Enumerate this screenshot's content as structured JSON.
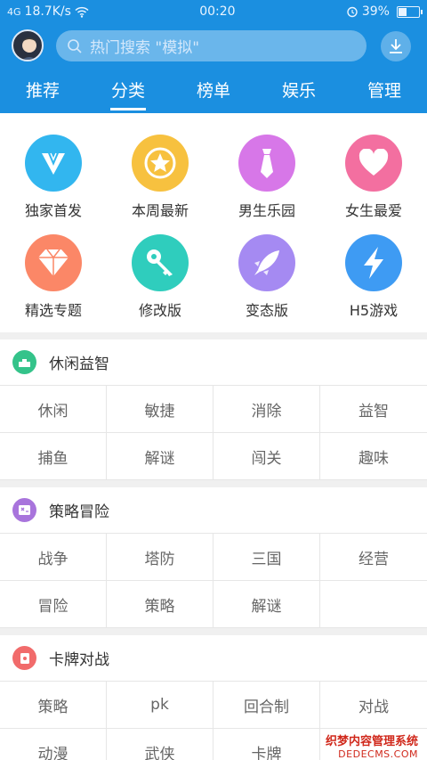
{
  "status": {
    "signal": "4G",
    "speed": "18.7K/s",
    "time": "00:20",
    "battery": "39%"
  },
  "search": {
    "placeholder": "热门搜索 \"模拟\""
  },
  "tabs": [
    {
      "label": "推荐",
      "active": false
    },
    {
      "label": "分类",
      "active": true
    },
    {
      "label": "榜单",
      "active": false
    },
    {
      "label": "娱乐",
      "active": false
    },
    {
      "label": "管理",
      "active": false
    }
  ],
  "categories": [
    {
      "label": "独家首发",
      "icon": "v-logo-icon",
      "color": "#32b6ef"
    },
    {
      "label": "本周最新",
      "icon": "star-badge-icon",
      "color": "#f7c13f"
    },
    {
      "label": "男生乐园",
      "icon": "tie-icon",
      "color": "#d777e8"
    },
    {
      "label": "女生最爱",
      "icon": "heart-icon",
      "color": "#f36fa0"
    },
    {
      "label": "精选专题",
      "icon": "diamond-icon",
      "color": "#fb8767"
    },
    {
      "label": "修改版",
      "icon": "key-icon",
      "color": "#2fcdbd"
    },
    {
      "label": "变态版",
      "icon": "rocket-icon",
      "color": "#a58af2"
    },
    {
      "label": "H5游戏",
      "icon": "lightning-icon",
      "color": "#3e9bf3"
    }
  ],
  "sections": [
    {
      "title": "休闲益智",
      "icon": "puzzle-icon",
      "color": "#34c38a",
      "items": [
        "休闲",
        "敏捷",
        "消除",
        "益智",
        "捕鱼",
        "解谜",
        "闯关",
        "趣味"
      ]
    },
    {
      "title": "策略冒险",
      "icon": "strategy-icon",
      "color": "#a874dc",
      "items": [
        "战争",
        "塔防",
        "三国",
        "经营",
        "冒险",
        "策略",
        "解谜",
        ""
      ]
    },
    {
      "title": "卡牌对战",
      "icon": "cards-icon",
      "color": "#f16b6b",
      "items": [
        "策略",
        "pk",
        "回合制",
        "对战",
        "动漫",
        "武侠",
        "卡牌",
        ""
      ]
    }
  ],
  "watermark": {
    "line1": "织梦内容管理系统",
    "line2": "DEDECMS.COM"
  }
}
